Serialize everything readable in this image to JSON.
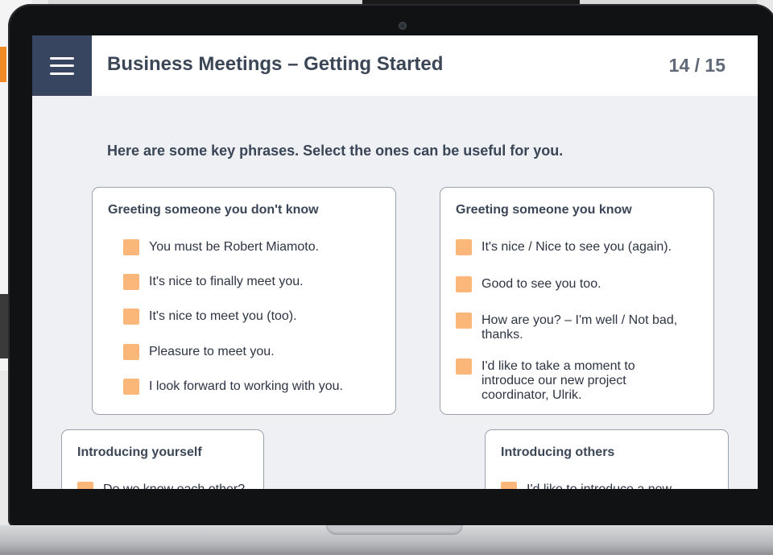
{
  "header": {
    "title": "Business Meetings – Getting Started",
    "progress": "14 / 15"
  },
  "instruction": "Here are some key phrases. Select the ones can be useful for you.",
  "cards": [
    {
      "heading": "Greeting someone you don't know",
      "items": [
        "You must be Robert Miamoto.",
        "It's nice to finally meet you.",
        "It's nice to meet you (too).",
        "Pleasure to meet you.",
        "I look forward to working with you."
      ]
    },
    {
      "heading": "Greeting someone you know",
      "items": [
        "It's nice / Nice to see you (again).",
        "Good to see you too.",
        "How are you? – I'm well / Not bad, thanks.",
        "I'd like to take a moment to introduce our new project coordinator, Ulrik."
      ]
    },
    {
      "heading": "Introducing yourself",
      "items": [
        "Do we know each other?"
      ]
    },
    {
      "heading": "Introducing others",
      "items": [
        "I'd like to introduce a new"
      ]
    }
  ],
  "colors": {
    "menu_bg": "#374561",
    "checkbox": "#fbb77a",
    "screen_bg": "#eef0f4"
  },
  "icons": {
    "menu": "hamburger-menu-icon",
    "camera": "webcam-icon"
  }
}
